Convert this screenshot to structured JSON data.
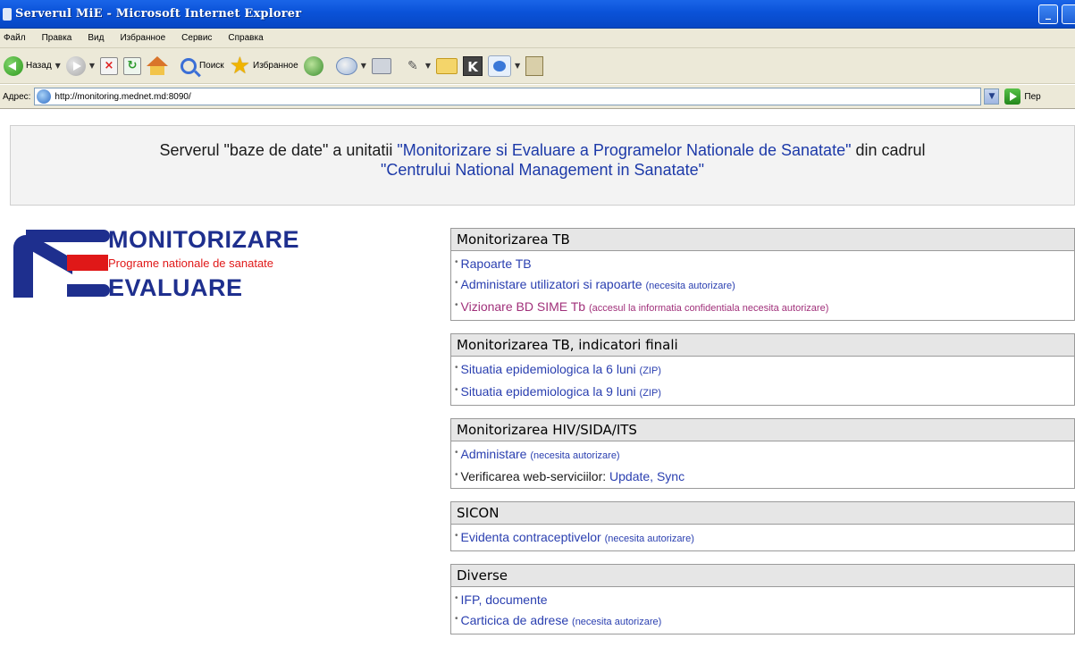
{
  "window": {
    "title": "Serverul MiE - Microsoft Internet Explorer"
  },
  "menu": [
    "Файл",
    "Правка",
    "Вид",
    "Избранное",
    "Сервис",
    "Справка"
  ],
  "toolbar": {
    "back_label": "Назад",
    "search_label": "Поиск",
    "favorites_label": "Избранное"
  },
  "address": {
    "label": "Адрес:",
    "url": "http://monitoring.mednet.md:8090/",
    "go_label": "Пер"
  },
  "header": {
    "part1": "Serverul \"baze de date\" a unitatii ",
    "link1": "\"Monitorizare si Evaluare a Programelor Nationale de Sanatate\"",
    "part2": " din cadrul",
    "link2": "\"Centrului National Management in Sanatate\""
  },
  "logo": {
    "line1": "MONITORIZARE",
    "line2": "Programe nationale de sanatate",
    "line3": "EVALUARE"
  },
  "sections": [
    {
      "title": "Monitorizarea TB",
      "items": [
        {
          "link": "Rapoarte TB",
          "note": ""
        },
        {
          "link": "Administare utilizatori si rapoarte",
          "note": "(necesita autorizare)"
        },
        {
          "link": "Vizionare BD SIME Tb",
          "note": "(accesul la informatia confidentiala necesita autorizare)"
        }
      ]
    },
    {
      "title": "Monitorizarea TB, indicatori finali",
      "items": [
        {
          "link": "Situatia epidemiologica la 6 luni",
          "note": "(ZIP)"
        },
        {
          "link": "Situatia epidemiologica la 9 luni",
          "note": "(ZIP)"
        }
      ]
    },
    {
      "title": "Monitorizarea HIV/SIDA/ITS",
      "items": [
        {
          "link": "Administare",
          "note": "(necesita autorizare)"
        },
        {
          "plain": "Verificarea web-serviciilor: ",
          "link_update": "Update",
          "sep": ", ",
          "link_sync": "Sync"
        }
      ]
    },
    {
      "title": "SICON",
      "items": [
        {
          "link": "Evidenta contraceptivelor",
          "note": "(necesita autorizare)"
        }
      ]
    },
    {
      "title": "Diverse",
      "items": [
        {
          "link": "IFP, documente",
          "note": ""
        },
        {
          "link": "Carticica de adrese",
          "note": "(necesita autorizare)"
        }
      ]
    }
  ],
  "colors": {
    "link": "#2a3fb0",
    "visited": "#a0307a",
    "logo_blue": "#1e2f8e",
    "logo_red": "#e01818"
  }
}
